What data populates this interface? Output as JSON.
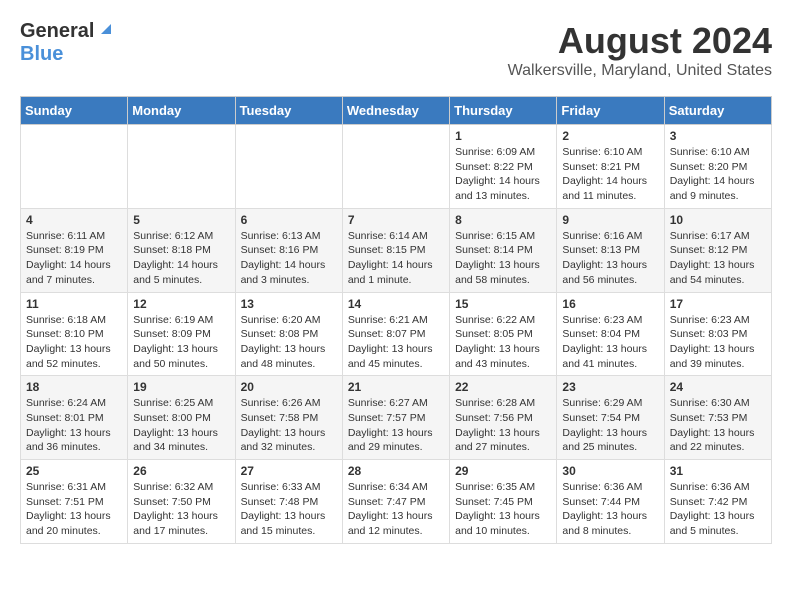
{
  "header": {
    "logo_general": "General",
    "logo_blue": "Blue",
    "month_year": "August 2024",
    "location": "Walkersville, Maryland, United States"
  },
  "weekdays": [
    "Sunday",
    "Monday",
    "Tuesday",
    "Wednesday",
    "Thursday",
    "Friday",
    "Saturday"
  ],
  "weeks": [
    [
      {
        "day": "",
        "info": ""
      },
      {
        "day": "",
        "info": ""
      },
      {
        "day": "",
        "info": ""
      },
      {
        "day": "",
        "info": ""
      },
      {
        "day": "1",
        "info": "Sunrise: 6:09 AM\nSunset: 8:22 PM\nDaylight: 14 hours\nand 13 minutes."
      },
      {
        "day": "2",
        "info": "Sunrise: 6:10 AM\nSunset: 8:21 PM\nDaylight: 14 hours\nand 11 minutes."
      },
      {
        "day": "3",
        "info": "Sunrise: 6:10 AM\nSunset: 8:20 PM\nDaylight: 14 hours\nand 9 minutes."
      }
    ],
    [
      {
        "day": "4",
        "info": "Sunrise: 6:11 AM\nSunset: 8:19 PM\nDaylight: 14 hours\nand 7 minutes."
      },
      {
        "day": "5",
        "info": "Sunrise: 6:12 AM\nSunset: 8:18 PM\nDaylight: 14 hours\nand 5 minutes."
      },
      {
        "day": "6",
        "info": "Sunrise: 6:13 AM\nSunset: 8:16 PM\nDaylight: 14 hours\nand 3 minutes."
      },
      {
        "day": "7",
        "info": "Sunrise: 6:14 AM\nSunset: 8:15 PM\nDaylight: 14 hours\nand 1 minute."
      },
      {
        "day": "8",
        "info": "Sunrise: 6:15 AM\nSunset: 8:14 PM\nDaylight: 13 hours\nand 58 minutes."
      },
      {
        "day": "9",
        "info": "Sunrise: 6:16 AM\nSunset: 8:13 PM\nDaylight: 13 hours\nand 56 minutes."
      },
      {
        "day": "10",
        "info": "Sunrise: 6:17 AM\nSunset: 8:12 PM\nDaylight: 13 hours\nand 54 minutes."
      }
    ],
    [
      {
        "day": "11",
        "info": "Sunrise: 6:18 AM\nSunset: 8:10 PM\nDaylight: 13 hours\nand 52 minutes."
      },
      {
        "day": "12",
        "info": "Sunrise: 6:19 AM\nSunset: 8:09 PM\nDaylight: 13 hours\nand 50 minutes."
      },
      {
        "day": "13",
        "info": "Sunrise: 6:20 AM\nSunset: 8:08 PM\nDaylight: 13 hours\nand 48 minutes."
      },
      {
        "day": "14",
        "info": "Sunrise: 6:21 AM\nSunset: 8:07 PM\nDaylight: 13 hours\nand 45 minutes."
      },
      {
        "day": "15",
        "info": "Sunrise: 6:22 AM\nSunset: 8:05 PM\nDaylight: 13 hours\nand 43 minutes."
      },
      {
        "day": "16",
        "info": "Sunrise: 6:23 AM\nSunset: 8:04 PM\nDaylight: 13 hours\nand 41 minutes."
      },
      {
        "day": "17",
        "info": "Sunrise: 6:23 AM\nSunset: 8:03 PM\nDaylight: 13 hours\nand 39 minutes."
      }
    ],
    [
      {
        "day": "18",
        "info": "Sunrise: 6:24 AM\nSunset: 8:01 PM\nDaylight: 13 hours\nand 36 minutes."
      },
      {
        "day": "19",
        "info": "Sunrise: 6:25 AM\nSunset: 8:00 PM\nDaylight: 13 hours\nand 34 minutes."
      },
      {
        "day": "20",
        "info": "Sunrise: 6:26 AM\nSunset: 7:58 PM\nDaylight: 13 hours\nand 32 minutes."
      },
      {
        "day": "21",
        "info": "Sunrise: 6:27 AM\nSunset: 7:57 PM\nDaylight: 13 hours\nand 29 minutes."
      },
      {
        "day": "22",
        "info": "Sunrise: 6:28 AM\nSunset: 7:56 PM\nDaylight: 13 hours\nand 27 minutes."
      },
      {
        "day": "23",
        "info": "Sunrise: 6:29 AM\nSunset: 7:54 PM\nDaylight: 13 hours\nand 25 minutes."
      },
      {
        "day": "24",
        "info": "Sunrise: 6:30 AM\nSunset: 7:53 PM\nDaylight: 13 hours\nand 22 minutes."
      }
    ],
    [
      {
        "day": "25",
        "info": "Sunrise: 6:31 AM\nSunset: 7:51 PM\nDaylight: 13 hours\nand 20 minutes."
      },
      {
        "day": "26",
        "info": "Sunrise: 6:32 AM\nSunset: 7:50 PM\nDaylight: 13 hours\nand 17 minutes."
      },
      {
        "day": "27",
        "info": "Sunrise: 6:33 AM\nSunset: 7:48 PM\nDaylight: 13 hours\nand 15 minutes."
      },
      {
        "day": "28",
        "info": "Sunrise: 6:34 AM\nSunset: 7:47 PM\nDaylight: 13 hours\nand 12 minutes."
      },
      {
        "day": "29",
        "info": "Sunrise: 6:35 AM\nSunset: 7:45 PM\nDaylight: 13 hours\nand 10 minutes."
      },
      {
        "day": "30",
        "info": "Sunrise: 6:36 AM\nSunset: 7:44 PM\nDaylight: 13 hours\nand 8 minutes."
      },
      {
        "day": "31",
        "info": "Sunrise: 6:36 AM\nSunset: 7:42 PM\nDaylight: 13 hours\nand 5 minutes."
      }
    ]
  ]
}
